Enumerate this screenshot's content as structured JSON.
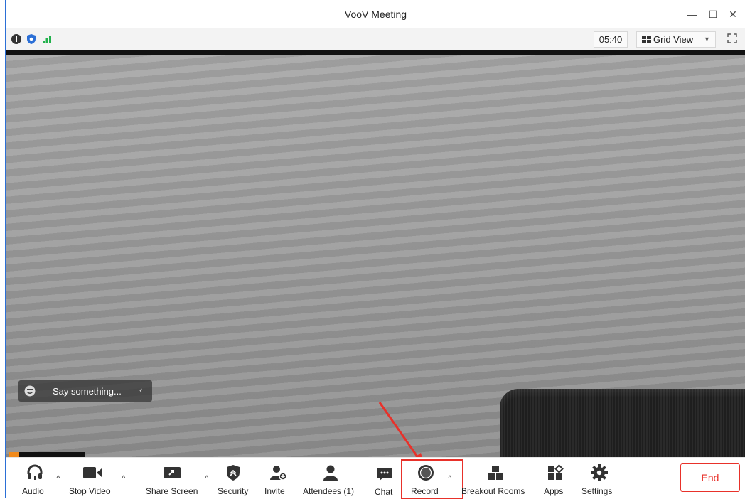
{
  "window": {
    "title": "VooV Meeting",
    "controls": {
      "minimize": "—",
      "maximize": "☐",
      "close": "✕"
    }
  },
  "statusbar": {
    "icons": [
      "info-icon",
      "shield-icon",
      "signal-icon"
    ],
    "timer": "05:40",
    "view_mode": "Grid View",
    "view_caret": "▼"
  },
  "chat": {
    "placeholder": "Say something...",
    "collapse": "‹"
  },
  "toolbar": {
    "audio": "Audio",
    "stop_video": "Stop Video",
    "share_screen": "Share Screen",
    "security": "Security",
    "invite": "Invite",
    "attendees": "Attendees (1)",
    "chat": "Chat",
    "record": "Record",
    "breakout_rooms": "Breakout Rooms",
    "apps": "Apps",
    "settings": "Settings",
    "caret": "^",
    "end": "End"
  },
  "colors": {
    "accent_blue": "#2b6fd6",
    "signal_green": "#22b14c",
    "highlight_red": "#e8312a",
    "end_red": "#e8312a"
  }
}
